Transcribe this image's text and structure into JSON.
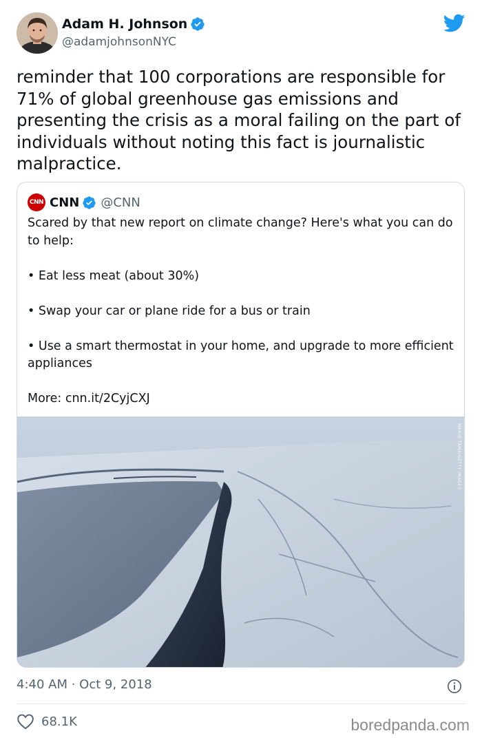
{
  "author": {
    "display_name": "Adam H. Johnson",
    "handle": "@adamjohnsonNYC",
    "verified": true,
    "avatar_icon": "avatar-photo"
  },
  "tweet": {
    "text": "reminder that 100 corporations are responsible for 71% of global greenhouse gas emissions and presenting the crisis as a moral failing on the part of individuals without noting this fact is journalistic malpractice.",
    "timestamp": "4:40 AM · Oct 9, 2018",
    "likes": "68.1K"
  },
  "quoted_tweet": {
    "logo_text": "CNN",
    "display_name": "CNN",
    "handle": "@CNN",
    "verified": true,
    "paragraphs": [
      "Scared by that new report on climate change? Here's what you can do to help:",
      "• Eat less meat (about 30%)",
      "• Swap your car or plane ride for a bus or train",
      "• Use a smart thermostat in your home, and upgrade to more efficient appliances",
      "More: cnn.it/2CyjCXJ"
    ],
    "photo_credit": "MARIO TAMA/GETTY IMAGES"
  },
  "watermark": "boredpanda.com",
  "colors": {
    "twitter_blue": "#1d9bf0",
    "text": "#0f1419",
    "secondary": "#536471",
    "cnn_red": "#cc0000"
  }
}
